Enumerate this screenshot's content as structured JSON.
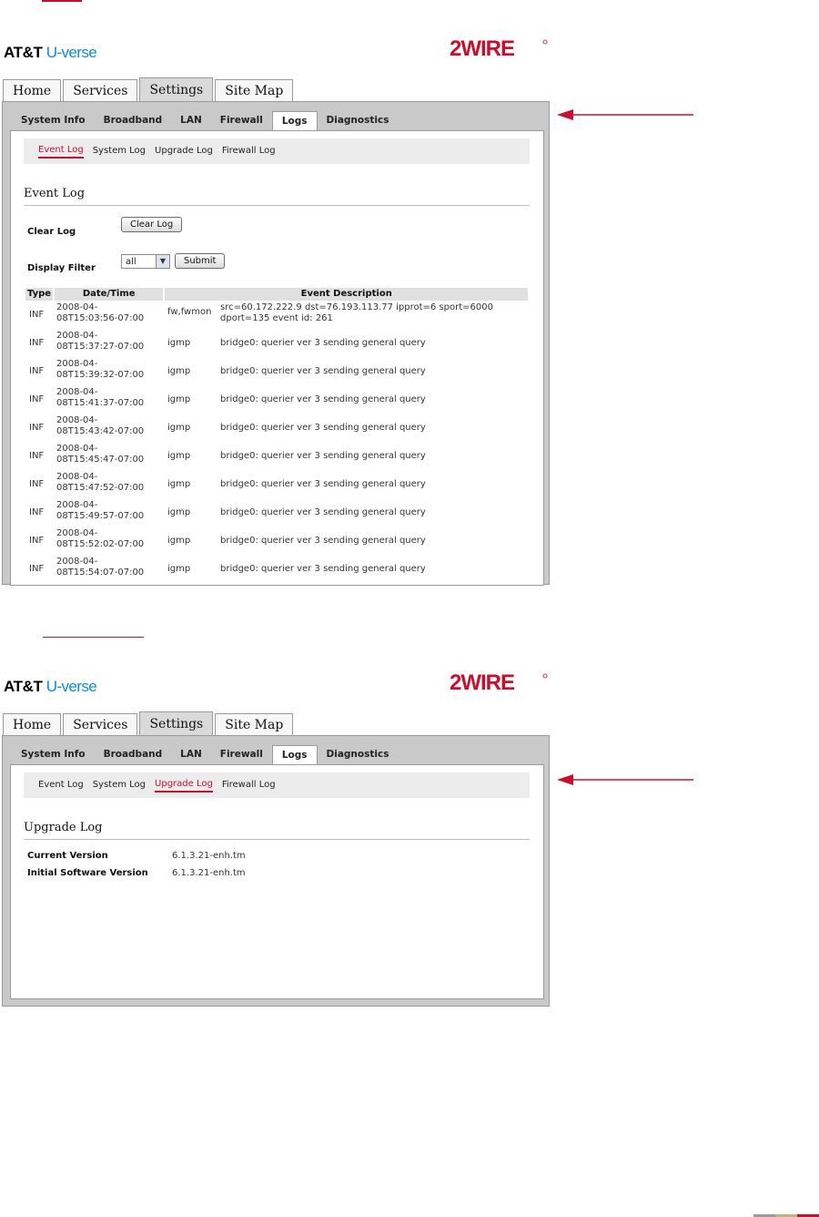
{
  "brand": {
    "att": "AT&T",
    "uverse": "U-verse",
    "logo_text": "2WIRE"
  },
  "colors": {
    "accent": "#c8102e",
    "uverse_blue": "#0a8fce",
    "footer": [
      "#9a9a9a",
      "#c9b27a",
      "#c8102e"
    ]
  },
  "main_tabs": [
    "Home",
    "Services",
    "Settings",
    "Site Map"
  ],
  "settings_tabs": [
    "System Info",
    "Broadband",
    "LAN",
    "Firewall",
    "Logs",
    "Diagnostics"
  ],
  "log_tabs": [
    "Event Log",
    "System Log",
    "Upgrade Log",
    "Firewall Log"
  ],
  "event_log": {
    "title": "Event Log",
    "clear_label": "Clear Log",
    "clear_button": "Clear Log",
    "filter_label": "Display Filter",
    "filter_value": "all",
    "submit_button": "Submit",
    "columns": [
      "Type",
      "Date/Time",
      "",
      "Event Description"
    ],
    "rows": [
      {
        "type": "INF",
        "date_line1": "2008-04-",
        "date_line2": "08T15:03:56-07:00",
        "module": "fw,fwmon",
        "desc_line1": "src=60.172.222.9 dst=76.193.113.77 ipprot=6 sport=6000",
        "desc_line2": "dport=135 event id: 261"
      },
      {
        "type": "INF",
        "date_line1": "2008-04-",
        "date_line2": "08T15:37:27-07:00",
        "module": "igmp",
        "desc_line1": "bridge0: querier ver 3 sending general query",
        "desc_line2": ""
      },
      {
        "type": "INF",
        "date_line1": "2008-04-",
        "date_line2": "08T15:39:32-07:00",
        "module": "igmp",
        "desc_line1": "bridge0: querier ver 3 sending general query",
        "desc_line2": ""
      },
      {
        "type": "INF",
        "date_line1": "2008-04-",
        "date_line2": "08T15:41:37-07:00",
        "module": "igmp",
        "desc_line1": "bridge0: querier ver 3 sending general query",
        "desc_line2": ""
      },
      {
        "type": "INF",
        "date_line1": "2008-04-",
        "date_line2": "08T15:43:42-07:00",
        "module": "igmp",
        "desc_line1": "bridge0: querier ver 3 sending general query",
        "desc_line2": ""
      },
      {
        "type": "INF",
        "date_line1": "2008-04-",
        "date_line2": "08T15:45:47-07:00",
        "module": "igmp",
        "desc_line1": "bridge0: querier ver 3 sending general query",
        "desc_line2": ""
      },
      {
        "type": "INF",
        "date_line1": "2008-04-",
        "date_line2": "08T15:47:52-07:00",
        "module": "igmp",
        "desc_line1": "bridge0: querier ver 3 sending general query",
        "desc_line2": ""
      },
      {
        "type": "INF",
        "date_line1": "2008-04-",
        "date_line2": "08T15:49:57-07:00",
        "module": "igmp",
        "desc_line1": "bridge0: querier ver 3 sending general query",
        "desc_line2": ""
      },
      {
        "type": "INF",
        "date_line1": "2008-04-",
        "date_line2": "08T15:52:02-07:00",
        "module": "igmp",
        "desc_line1": "bridge0: querier ver 3 sending general query",
        "desc_line2": ""
      },
      {
        "type": "INF",
        "date_line1": "2008-04-",
        "date_line2": "08T15:54:07-07:00",
        "module": "igmp",
        "desc_line1": "bridge0: querier ver 3 sending general query",
        "desc_line2": ""
      }
    ]
  },
  "upgrade_log": {
    "title": "Upgrade Log",
    "current_label": "Current Version",
    "current_value": "6.1.3.21-enh.tm",
    "initial_label": "Initial Software Version",
    "initial_value": "6.1.3.21-enh.tm"
  }
}
